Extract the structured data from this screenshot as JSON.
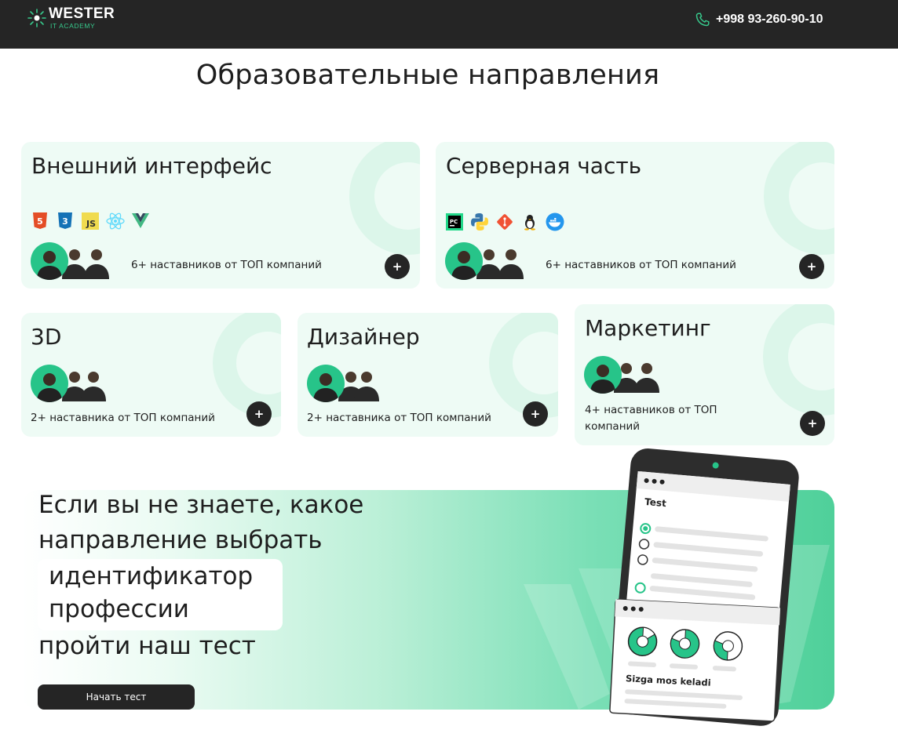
{
  "header": {
    "logo_title": "WESTER",
    "logo_subtitle": "IT ACADEMY",
    "phone": "+998 93-260-90-10",
    "phone_icon": "phone-icon"
  },
  "page_title": "Образовательные направления",
  "cards": {
    "frontend": {
      "title": "Внешний интерфейс",
      "mentors": "6+ наставников от ТОП компаний",
      "tech_icons": [
        "html5-icon",
        "css3-icon",
        "js-icon",
        "react-icon",
        "vue-icon"
      ],
      "tech_labels": [
        "5",
        "3",
        "JS"
      ]
    },
    "backend": {
      "title": "Серверная часть",
      "mentors": "6+ наставников от ТОП компаний",
      "tech_icons": [
        "pycharm-icon",
        "python-icon",
        "git-icon",
        "linux-icon",
        "docker-icon"
      ],
      "tech_labels": [
        "PC"
      ]
    },
    "threed": {
      "title": "3D",
      "mentors": "2+ наставника от ТОП компаний"
    },
    "designer": {
      "title": "Дизайнер",
      "mentors": "2+ наставника от ТОП компаний"
    },
    "marketing": {
      "title": "Маркетинг",
      "mentors": "4+ наставников от ТОП компаний"
    },
    "plus_label": "+"
  },
  "banner": {
    "line1": "Если вы не знаете, какое",
    "line2": "направление выбрать",
    "highlight1": "идентификатор",
    "highlight2": "профессии",
    "line3": "пройти наш тест",
    "button": "Начать тест",
    "illustration": {
      "test_title": "Test",
      "result_text": "Sizga mos keladi"
    }
  },
  "colors": {
    "accent": "#27c489",
    "header_bg": "#252525",
    "card_bg": "#eefbf5"
  }
}
